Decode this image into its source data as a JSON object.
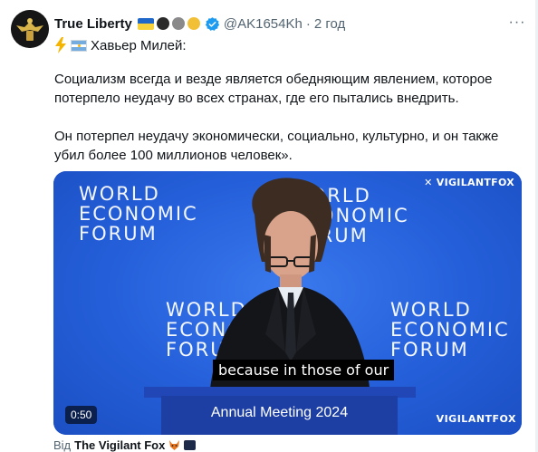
{
  "post": {
    "display_name": "True Liberty",
    "handle": "@AK1654Kh",
    "separator": "·",
    "time": "2 год",
    "more_label": "···",
    "intro_text": "Хавьер Милей:",
    "paragraph_1": "Социализм всегда и везде является обедняющим явлением, которое потерпело неудачу во всех странах, где его пытались внедрить.",
    "paragraph_2": "Он потерпел неудачу экономически, социально, культурно, и он также убил более 100 миллионов человек».",
    "from_prefix": "Від",
    "from_name": "The Vigilant Fox"
  },
  "video": {
    "watermark": "✕ VIGILANTFOX",
    "bottom_watermark": "VIGILANTFOX",
    "wef_line1": "WORLD",
    "wef_line2": "ECONOMIC",
    "wef_line3": "FORUM",
    "caption": "because in those of our",
    "podium_text": "Annual Meeting 2024",
    "duration": "0:50"
  },
  "colors": {
    "accent": "#1d9bf0",
    "muted": "#536471",
    "video_blue": "#245fd9"
  },
  "icons": {
    "avatar": "eagle-emblem",
    "flag_ukraine": "flag-ua-icon",
    "verified": "verified-badge-icon",
    "lightning": "lightning-icon",
    "flag_argentina": "flag-ar-icon",
    "more": "more-icon"
  }
}
